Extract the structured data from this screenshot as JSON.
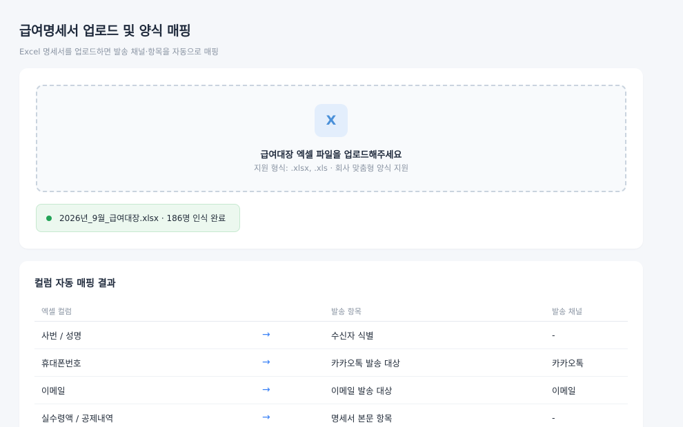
{
  "header": {
    "title": "급여명세서 업로드 및 양식 매핑",
    "subtitle": "Excel 명세서를 업로드하면 발송 채널·항목을 자동으로 매핑"
  },
  "upload": {
    "icon_text": "X",
    "title": "급여대장 엑셀 파일을 업로드해주세요",
    "subtitle": "지원 형식: .xlsx, .xls · 회사 맞춤형 양식 지원",
    "status_text": "2026년_9월_급여대장.xlsx · 186명 인식 완료",
    "status_color": "#22a356"
  },
  "mapping": {
    "title": "컬럼 자동 매핑 결과",
    "columns": [
      "엑셀 컬럼",
      "",
      "발송 항목",
      "발송 채널"
    ],
    "rows": [
      {
        "source": "사번 / 성명",
        "arrow": "→",
        "target": "수신자 식별",
        "channel": "-"
      },
      {
        "source": "휴대폰번호",
        "arrow": "→",
        "target": "카카오톡 발송 대상",
        "channel": "카카오톡"
      },
      {
        "source": "이메일",
        "arrow": "→",
        "target": "이메일 발송 대상",
        "channel": "이메일"
      },
      {
        "source": "실수령액 / 공제내역",
        "arrow": "→",
        "target": "명세서 본문 항목",
        "channel": "-"
      }
    ]
  }
}
